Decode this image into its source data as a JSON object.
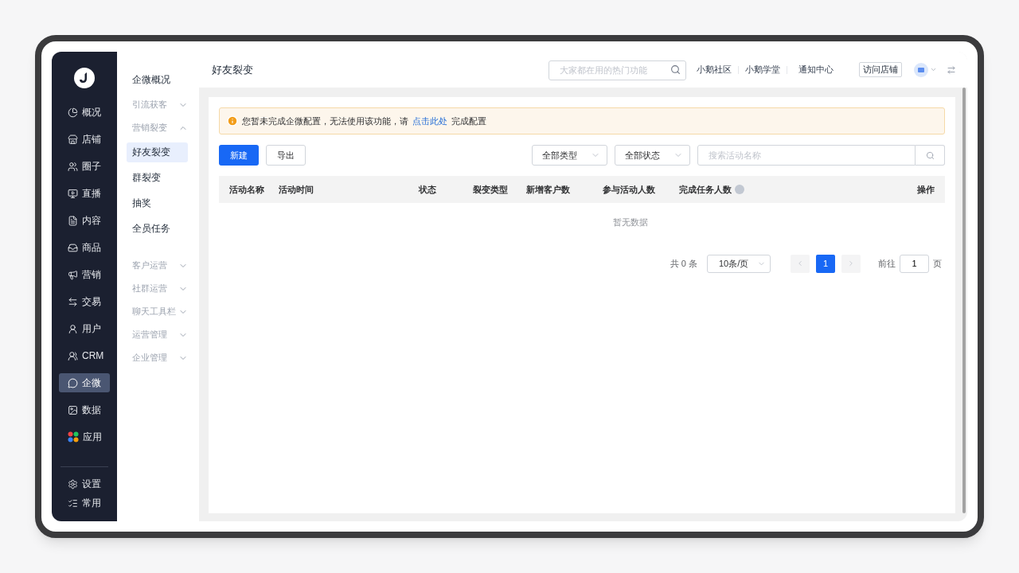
{
  "rail": {
    "items": [
      {
        "label": "概况",
        "selected": false
      },
      {
        "label": "店铺",
        "selected": false
      },
      {
        "label": "圈子",
        "selected": false
      },
      {
        "label": "直播",
        "selected": false
      },
      {
        "label": "内容",
        "selected": false
      },
      {
        "label": "商品",
        "selected": false
      },
      {
        "label": "营销",
        "selected": false
      },
      {
        "label": "交易",
        "selected": false
      },
      {
        "label": "用户",
        "selected": false
      },
      {
        "label": "CRM",
        "selected": false
      },
      {
        "label": "企微",
        "selected": true
      },
      {
        "label": "数据",
        "selected": false
      },
      {
        "label": "应用",
        "selected": false
      }
    ],
    "bottom_items": [
      {
        "label": "设置"
      },
      {
        "label": "常用"
      }
    ]
  },
  "submenu": [
    {
      "kind": "link",
      "label": "企微概况",
      "selected": false
    },
    {
      "kind": "group",
      "label": "引流获客",
      "expanded": false
    },
    {
      "kind": "group",
      "label": "营销裂变",
      "expanded": true,
      "children": [
        {
          "label": "好友裂变",
          "selected": true
        },
        {
          "label": "群裂变",
          "selected": false
        },
        {
          "label": "抽奖",
          "selected": false
        },
        {
          "label": "全员任务",
          "selected": false
        }
      ]
    },
    {
      "kind": "group",
      "label": "客户运营",
      "expanded": false
    },
    {
      "kind": "group",
      "label": "社群运营",
      "expanded": false
    },
    {
      "kind": "group",
      "label": "聊天工具栏",
      "expanded": false
    },
    {
      "kind": "group",
      "label": "运营管理",
      "expanded": false
    },
    {
      "kind": "group",
      "label": "企业管理",
      "expanded": false
    }
  ],
  "header": {
    "title": "好友裂变",
    "search_placeholder": "大家都在用的热门功能",
    "links": [
      "小鹅社区",
      "小鹅学堂",
      "通知中心"
    ],
    "visit_button": "访问店铺"
  },
  "alert": {
    "text": "您暂未完成企微配置，无法使用该功能，请",
    "link": "点击此处",
    "text_after": "完成配置"
  },
  "toolbar": {
    "buttons": [
      {
        "label": "新建",
        "kind": "primary"
      },
      {
        "label": "导出",
        "kind": "default"
      }
    ],
    "filters": [
      "全部类型",
      "全部状态"
    ],
    "search_placeholder": "搜索活动名称"
  },
  "table": {
    "columns": [
      {
        "label": "活动名称",
        "info": false
      },
      {
        "label": "活动时间",
        "info": false
      },
      {
        "label": "状态",
        "info": false
      },
      {
        "label": "裂变类型",
        "info": false
      },
      {
        "label": "新增客户数",
        "info": false
      },
      {
        "label": "参与活动人数",
        "info": false
      },
      {
        "label": "完成任务人数",
        "info": true
      },
      {
        "label": "操作",
        "info": false
      }
    ],
    "empty_text": "暂无数据"
  },
  "pagination": {
    "total": "共 0 条",
    "page_size": "10条/页",
    "pages": [
      {
        "label": "1",
        "selected": true
      }
    ],
    "goto_label": "前往",
    "goto_value": "1",
    "page_suffix": "页"
  }
}
